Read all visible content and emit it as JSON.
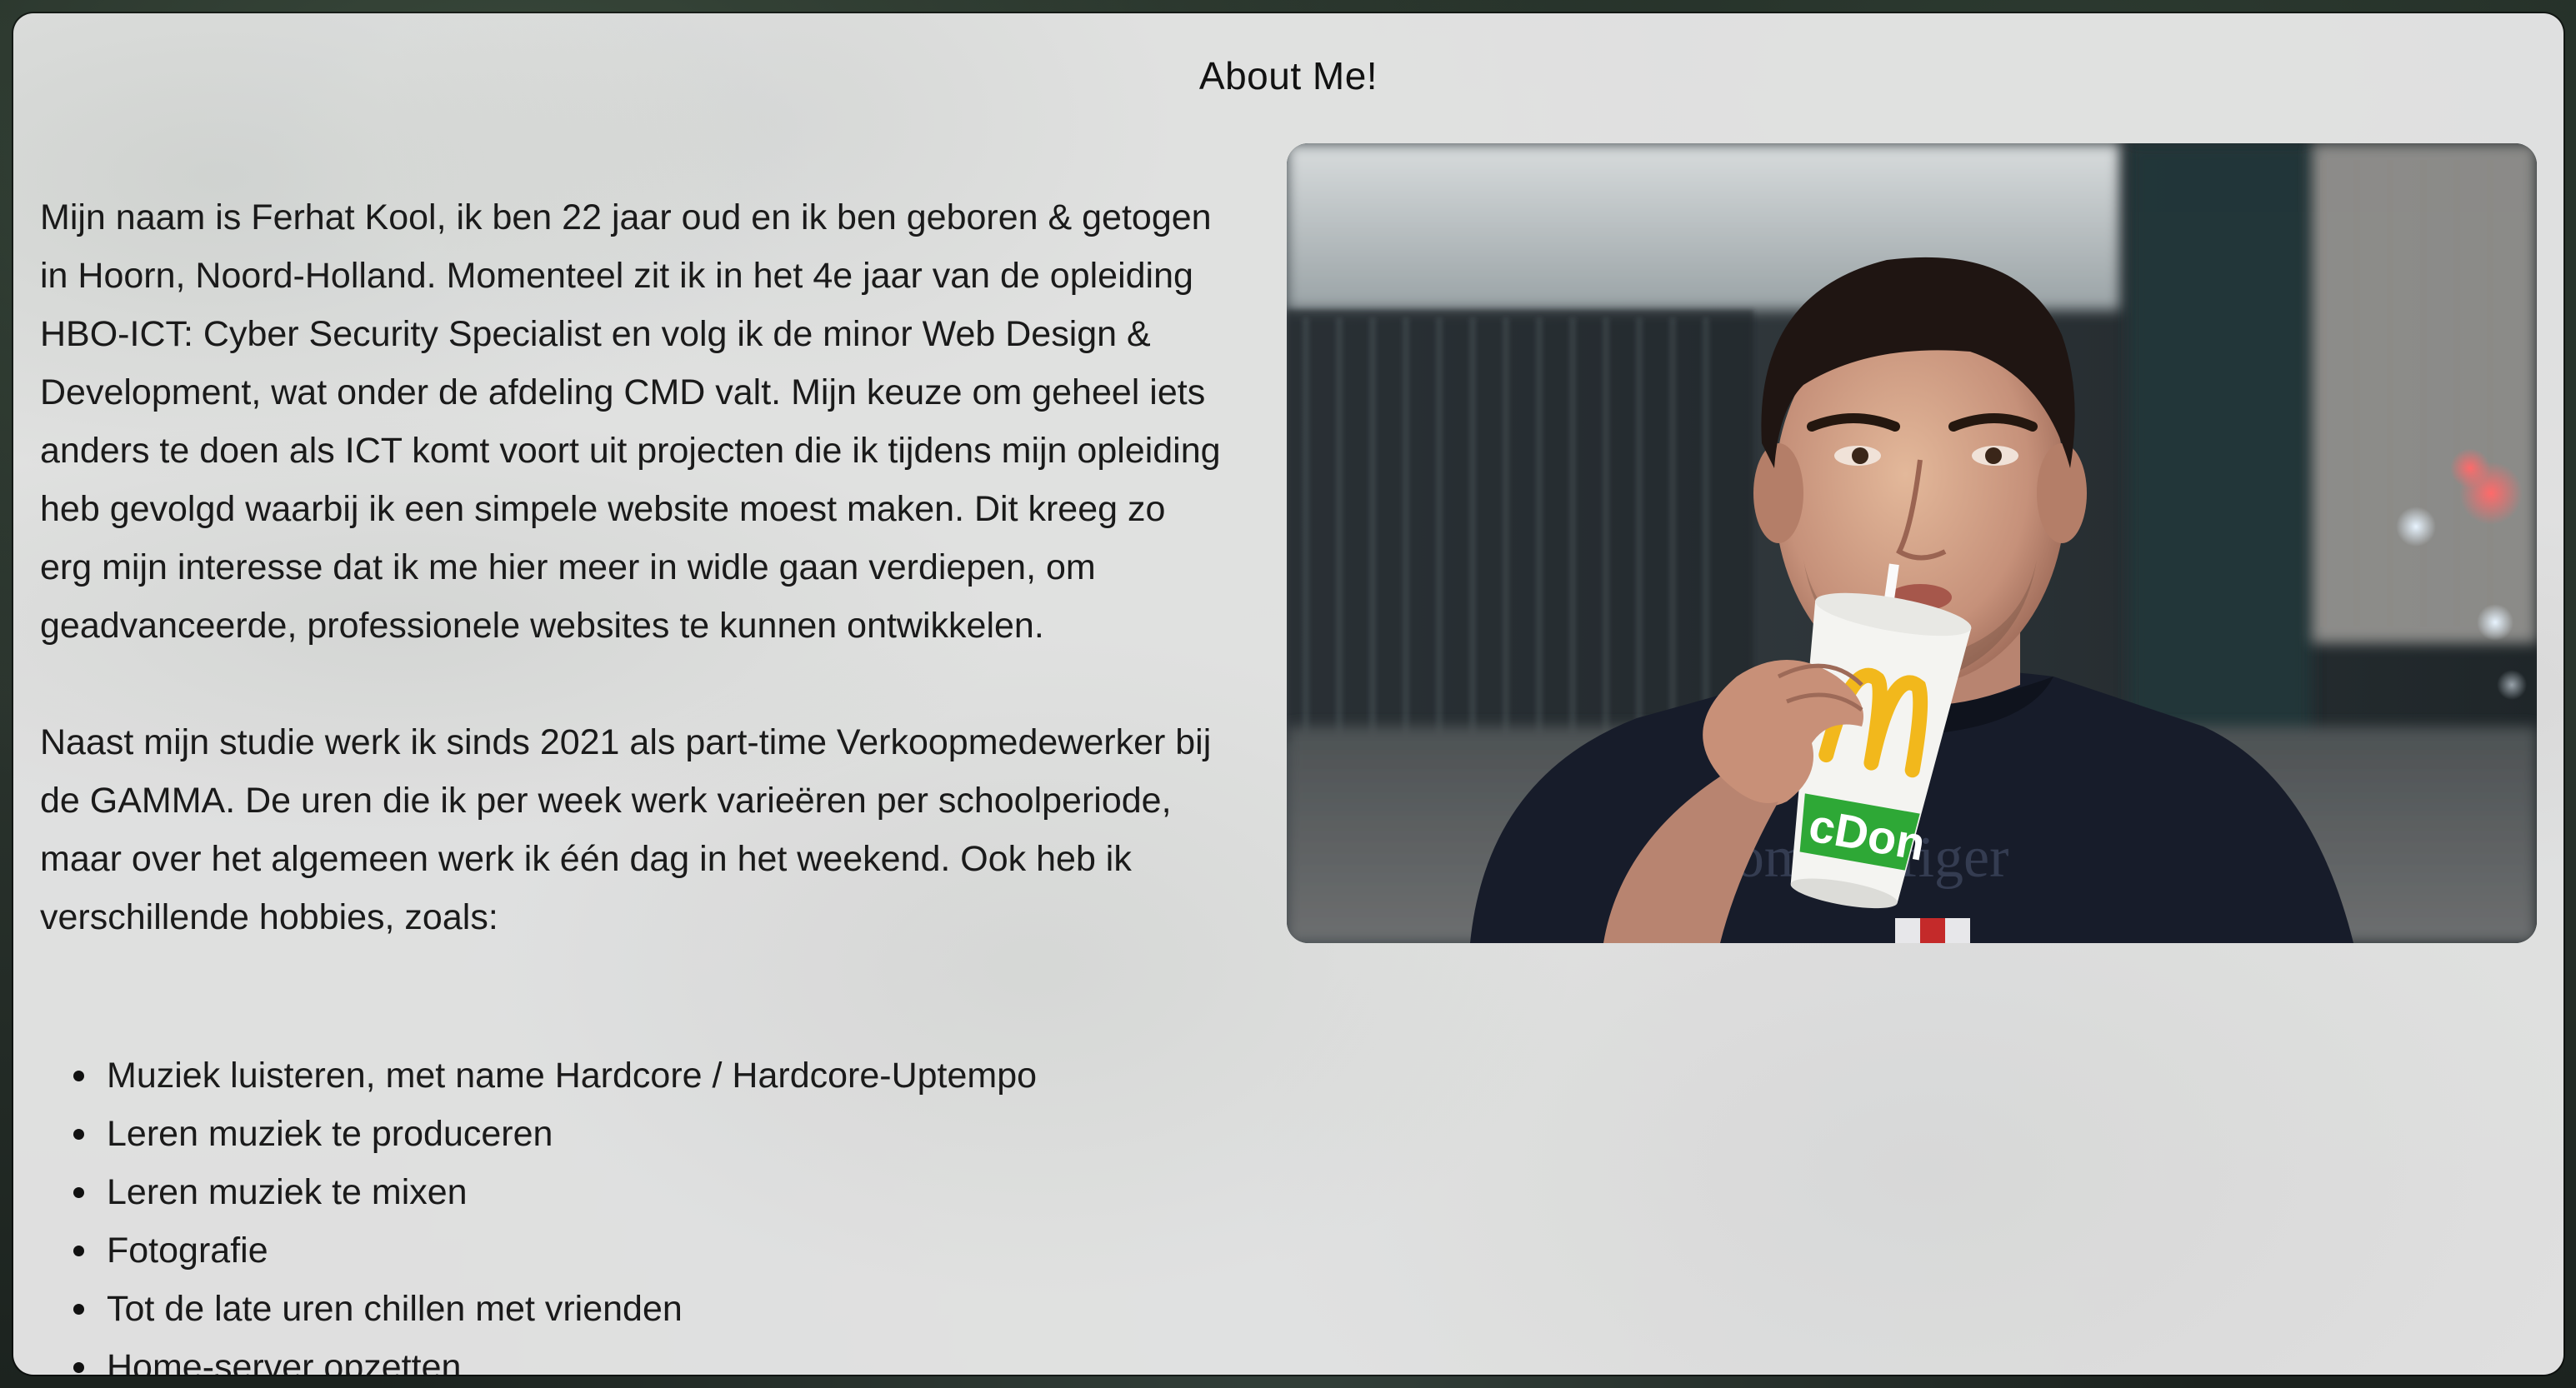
{
  "page": {
    "title": "About Me!"
  },
  "intro": {
    "paragraph_1": "Mijn naam is Ferhat Kool, ik ben 22 jaar oud en ik ben geboren & getogen in Hoorn, Noord-Holland. Momenteel zit ik in het 4e jaar van de opleiding HBO-ICT: Cyber Security Specialist en volg ik de minor Web Design & Development, wat onder de afdeling CMD valt. Mijn keuze om geheel iets anders te doen als ICT komt voort uit projecten die ik tijdens mijn opleiding heb gevolgd waarbij ik een simpele website moest maken. Dit kreeg zo erg mijn interesse dat ik me hier meer in widle gaan verdiepen, om geadvanceerde, professionele websites te kunnen ontwikkelen.",
    "paragraph_2": "Naast mijn studie werk ik sinds 2021 als part-time Verkoopmedewerker bij de GAMMA. De uren die ik per week werk varieëren per schoolperiode, maar over het algemeen werk ik één dag in het weekend. Ook heb ik verschillende hobbies, zoals:"
  },
  "hobbies": [
    "Muziek luisteren, met name Hardcore / Hardcore-Uptempo",
    "Leren muziek te produceren",
    "Leren muziek te mixen",
    "Fotografie",
    "Tot de late uren chillen met vrienden",
    "Home-server opzetten"
  ],
  "photo": {
    "subject": "portrait photo of person drinking from a McDonald's cup",
    "cup_text": "cDon",
    "shirt_text": "Tom Hilfiger"
  },
  "colors": {
    "panel_background": "#eeeeee",
    "text": "#1a1a1a",
    "cup_yellow": "#f2b81c",
    "cup_green": "#2ea836"
  }
}
